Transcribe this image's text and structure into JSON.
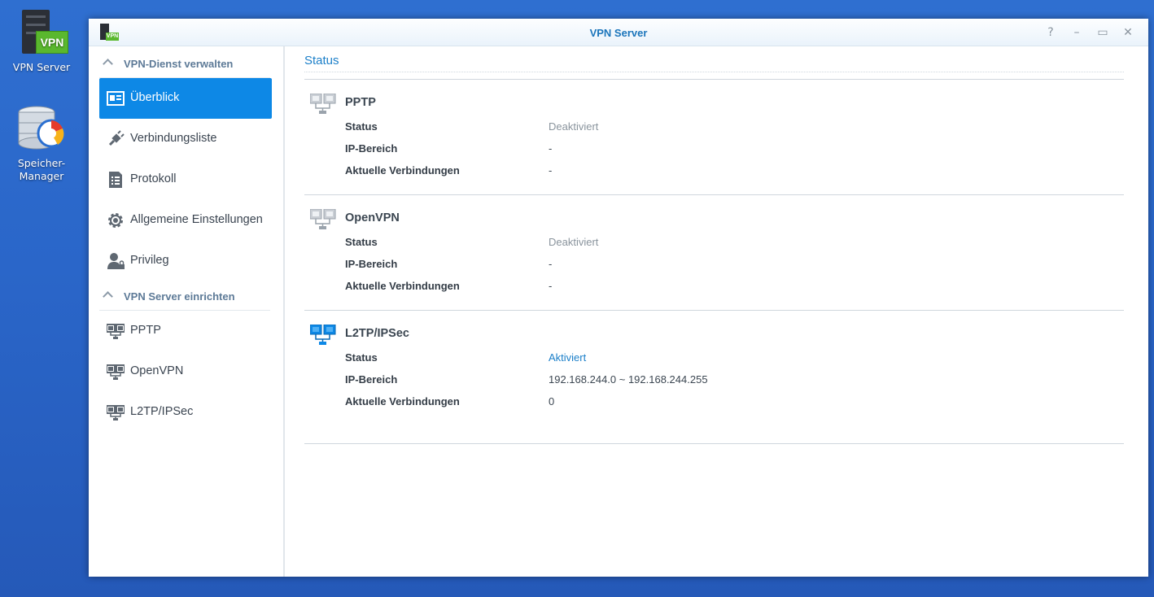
{
  "desktop": {
    "icons": [
      {
        "label": "VPN Server",
        "badge": "VPN"
      },
      {
        "label": "Speicher-Manager"
      }
    ]
  },
  "window": {
    "title": "VPN Server",
    "app_icon_badge": "VPN",
    "controls": {
      "help": "?",
      "minimize": "–",
      "maximize": "▭",
      "close": "✕"
    }
  },
  "sidebar": {
    "sections": [
      {
        "label": "VPN-Dienst verwalten",
        "items": [
          {
            "label": "Überblick",
            "icon": "overview-card-icon",
            "active": true
          },
          {
            "label": "Verbindungsliste",
            "icon": "plug-icon"
          },
          {
            "label": "Protokoll",
            "icon": "log-list-icon"
          },
          {
            "label": "Allgemeine Einstellungen",
            "icon": "gear-icon"
          },
          {
            "label": "Privileg",
            "icon": "user-lock-icon"
          }
        ]
      },
      {
        "label": "VPN Server einrichten",
        "items": [
          {
            "label": "PPTP",
            "icon": "network-icon"
          },
          {
            "label": "OpenVPN",
            "icon": "network-icon"
          },
          {
            "label": "L2TP/IPSec",
            "icon": "network-icon"
          }
        ]
      }
    ]
  },
  "main": {
    "tab": "Status",
    "services": [
      {
        "name": "PPTP",
        "enabled": false,
        "rows": [
          {
            "label": "Status",
            "value": "Deaktiviert"
          },
          {
            "label": "IP-Bereich",
            "value": "-"
          },
          {
            "label": "Aktuelle Verbindungen",
            "value": "-"
          }
        ]
      },
      {
        "name": "OpenVPN",
        "enabled": false,
        "rows": [
          {
            "label": "Status",
            "value": "Deaktiviert"
          },
          {
            "label": "IP-Bereich",
            "value": "-"
          },
          {
            "label": "Aktuelle Verbindungen",
            "value": "-"
          }
        ]
      },
      {
        "name": "L2TP/IPSec",
        "enabled": true,
        "rows": [
          {
            "label": "Status",
            "value": "Aktiviert"
          },
          {
            "label": "IP-Bereich",
            "value": "192.168.244.0 ~ 192.168.244.255"
          },
          {
            "label": "Aktuelle Verbindungen",
            "value": "0"
          }
        ]
      }
    ]
  },
  "colors": {
    "accent": "#0d88e6",
    "link": "#1b7fc9",
    "desktop": "#2a66c9",
    "vpn_green": "#5ab82e",
    "inactive_text": "#8a949d"
  }
}
